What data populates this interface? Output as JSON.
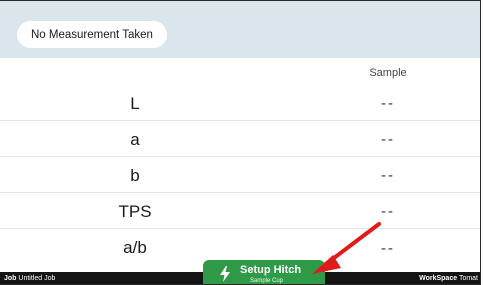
{
  "header": {
    "status": "No Measurement Taken"
  },
  "table": {
    "column_header": "Sample",
    "rows": [
      {
        "label": "L",
        "value": "--"
      },
      {
        "label": "a",
        "value": "--"
      },
      {
        "label": "b",
        "value": "--"
      },
      {
        "label": "TPS",
        "value": "--"
      },
      {
        "label": "a/b",
        "value": "--"
      }
    ]
  },
  "footer": {
    "job_label": "Job",
    "job_name": "Untitled Job",
    "workspace_label": "WorkSpace",
    "workspace_name": "Tomat"
  },
  "setup_button": {
    "title": "Setup Hitch",
    "subtitle": "Sample Cup",
    "icon": "lightning-bolt-icon",
    "color": "#2f9a47"
  },
  "annotation": {
    "arrow_color": "#e01b1b"
  }
}
